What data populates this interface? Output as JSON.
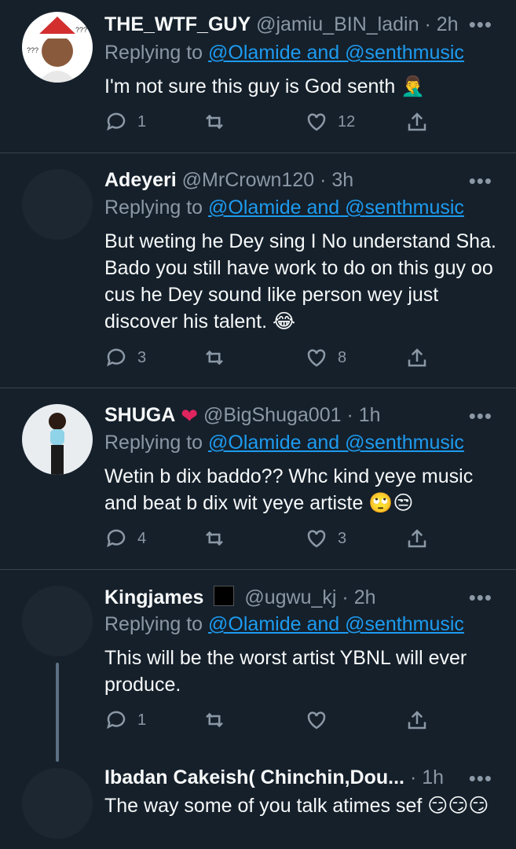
{
  "tweets": [
    {
      "name": "THE_WTF_GUY",
      "handle": "@jamiu_BIN_ladin",
      "time": "2h",
      "replying_prefix": "Replying to",
      "replying_to": "@Olamide and @senthmusic",
      "text": "I'm not sure this guy is God senth 🤦‍♂️",
      "replies": "1",
      "retweets": "",
      "likes": "12"
    },
    {
      "name": "Adeyeri",
      "handle": "@MrCrown120",
      "time": "3h",
      "replying_prefix": "Replying to",
      "replying_to": "@Olamide and @senthmusic",
      "text": "But weting he Dey sing I No understand Sha. Bado you still have work to do on this guy oo cus he Dey sound like person wey just discover his talent. 😂",
      "replies": "3",
      "retweets": "",
      "likes": "8"
    },
    {
      "name": "SHUGA",
      "handle": "@BigShuga001",
      "time": "1h",
      "replying_prefix": "Replying to",
      "replying_to": "@Olamide and @senthmusic",
      "text": "Wetin b dix baddo?? Whc kind yeye music and beat b dix wit yeye artiste 🙄😒",
      "replies": "4",
      "retweets": "",
      "likes": "3"
    },
    {
      "name": "Kingjames",
      "handle": "@ugwu_kj",
      "time": "2h",
      "replying_prefix": "Replying to",
      "replying_to": "@Olamide and @senthmusic",
      "text": "This will be the worst artist YBNL will ever produce.",
      "replies": "1",
      "retweets": "",
      "likes": ""
    },
    {
      "name": "Ibadan Cakeish( Chinchin,Dou...",
      "handle": "",
      "time": "1h",
      "text": "The way some of you talk atimes sef 😏😏😏"
    }
  ],
  "separator": "·",
  "more_glyph": "•••",
  "colors": {
    "background": "#15202b",
    "link": "#1d9bf0",
    "muted": "#8b98a5",
    "text": "#f7f9f9"
  }
}
